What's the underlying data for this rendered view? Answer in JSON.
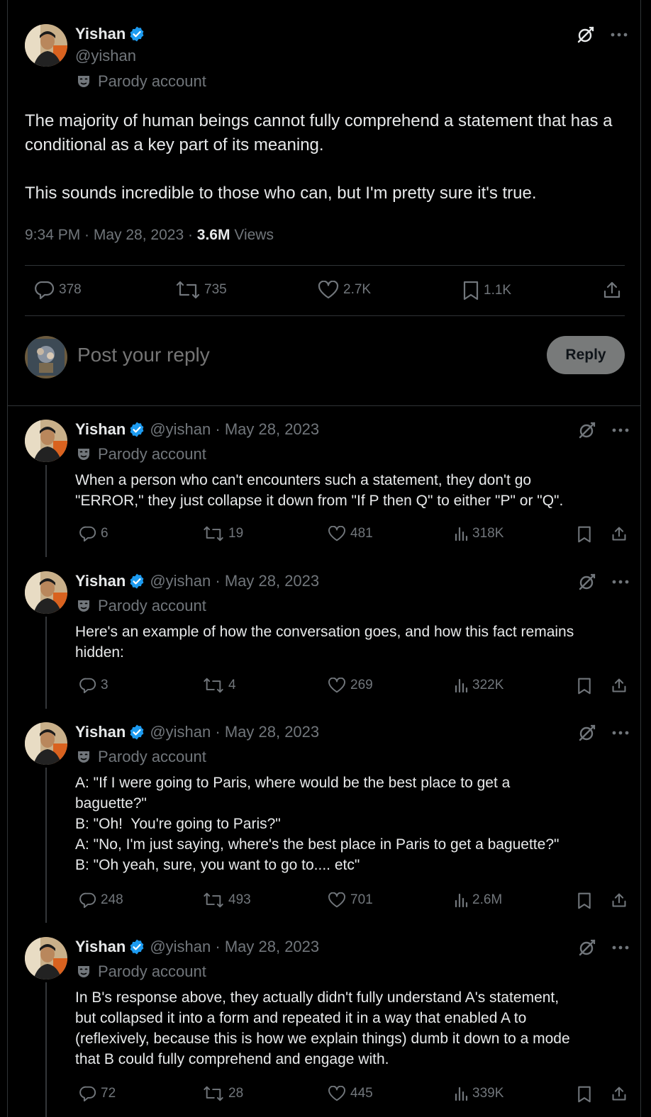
{
  "main_tweet": {
    "name": "Yishan",
    "handle": "@yishan",
    "parody_label": "Parody account",
    "text": "The majority of human beings cannot fully comprehend a statement that has a conditional as a key part of its meaning.\n\nThis sounds incredible to those who can, but I'm pretty sure it's true.",
    "time": "9:34 PM · May 28, 2023 · ",
    "views_count": "3.6M",
    "views_label": " Views",
    "stats": {
      "replies": "378",
      "reposts": "735",
      "likes": "2.7K",
      "bookmarks": "1.1K"
    },
    "reply_placeholder": "Post your reply",
    "reply_button": "Reply"
  },
  "replies": [
    {
      "name": "Yishan",
      "handle": "@yishan",
      "sep": " · ",
      "date": "May 28, 2023",
      "parody_label": "Parody account",
      "lines": [
        "When a person who can't encounters such a statement, they don't go",
        "\"ERROR,\" they just collapse it down from \"If P then Q\" to either \"P\" or \"Q\"."
      ],
      "stats": {
        "replies": "6",
        "reposts": "19",
        "likes": "481",
        "views": "318K"
      }
    },
    {
      "name": "Yishan",
      "handle": "@yishan",
      "sep": " · ",
      "date": "May 28, 2023",
      "parody_label": "Parody account",
      "lines": [
        "Here's an example of how the conversation goes, and how this fact remains",
        "hidden:"
      ],
      "stats": {
        "replies": "3",
        "reposts": "4",
        "likes": "269",
        "views": "322K"
      }
    },
    {
      "name": "Yishan",
      "handle": "@yishan",
      "sep": " · ",
      "date": "May 28, 2023",
      "parody_label": "Parody account",
      "lines": [
        "A: \"If I were going to Paris, where would be the best place to get a",
        "baguette?\"",
        "B: \"Oh!  You're going to Paris?\"",
        "A: \"No, I'm just saying, where's the best place in Paris to get a baguette?\"",
        "B: \"Oh yeah, sure, you want to go to.... etc\""
      ],
      "stats": {
        "replies": "248",
        "reposts": "493",
        "likes": "701",
        "views": "2.6M"
      }
    },
    {
      "name": "Yishan",
      "handle": "@yishan",
      "sep": " · ",
      "date": "May 28, 2023",
      "parody_label": "Parody account",
      "lines": [
        "In B's response above, they actually didn't fully understand A's statement,",
        "but collapsed it into a form and repeated it in a way that enabled A to",
        "(reflexively, because this is how we explain things) dumb it down to a mode",
        "that B could fully comprehend and engage with."
      ],
      "stats": {
        "replies": "72",
        "reposts": "28",
        "likes": "445",
        "views": "339K"
      }
    }
  ],
  "colors": {
    "background": "#000000",
    "text": "#e7e9ea",
    "muted": "#71767b",
    "verified": "#1d9bf0",
    "divider": "#2f3336"
  }
}
